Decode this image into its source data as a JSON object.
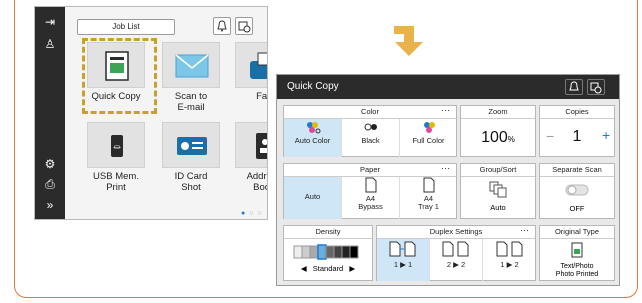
{
  "home": {
    "job_list_label": "Job List",
    "tiles": [
      {
        "label": "Quick Copy",
        "icon": "copy-icon"
      },
      {
        "label": "Scan to\nE-mail",
        "icon": "envelope-icon"
      },
      {
        "label": "Fax",
        "icon": "fax-icon"
      },
      {
        "label": "USB Mem.\nPrint",
        "icon": "usb-icon"
      },
      {
        "label": "ID Card\nShot",
        "icon": "id-card-icon"
      },
      {
        "label": "Address\nBook",
        "icon": "address-book-icon"
      }
    ]
  },
  "quick_copy": {
    "title": "Quick Copy",
    "color": {
      "title": "Color",
      "options": [
        "Auto Color",
        "Black",
        "Full Color"
      ],
      "selected": "Auto Color"
    },
    "zoom": {
      "title": "Zoom",
      "value": "100",
      "unit": "%"
    },
    "copies": {
      "title": "Copies",
      "value": "1",
      "minus": "−",
      "plus": "+"
    },
    "paper": {
      "title": "Paper",
      "options": [
        "Auto",
        "A4\nBypass",
        "A4\nTray 1"
      ],
      "selected": "Auto"
    },
    "group_sort": {
      "title": "Group/Sort",
      "value": "Auto"
    },
    "separate_scan": {
      "title": "Separate Scan",
      "value": "OFF"
    },
    "density": {
      "title": "Density",
      "value": "Standard",
      "left": "◀",
      "right": "▶"
    },
    "duplex": {
      "title": "Duplex Settings",
      "options": [
        "1 ▶ 1",
        "2 ▶ 2",
        "1 ▶ 2"
      ],
      "selected": "1 ▶ 1"
    },
    "original_type": {
      "title": "Original Type",
      "value": "Text/Photo\nPhoto Printed"
    },
    "more_label": "···"
  },
  "colors": {
    "accent": "#1e7ad6",
    "highlight": "#c9a02a",
    "arrow": "#e9b24a",
    "frame": "#e07a3b"
  }
}
